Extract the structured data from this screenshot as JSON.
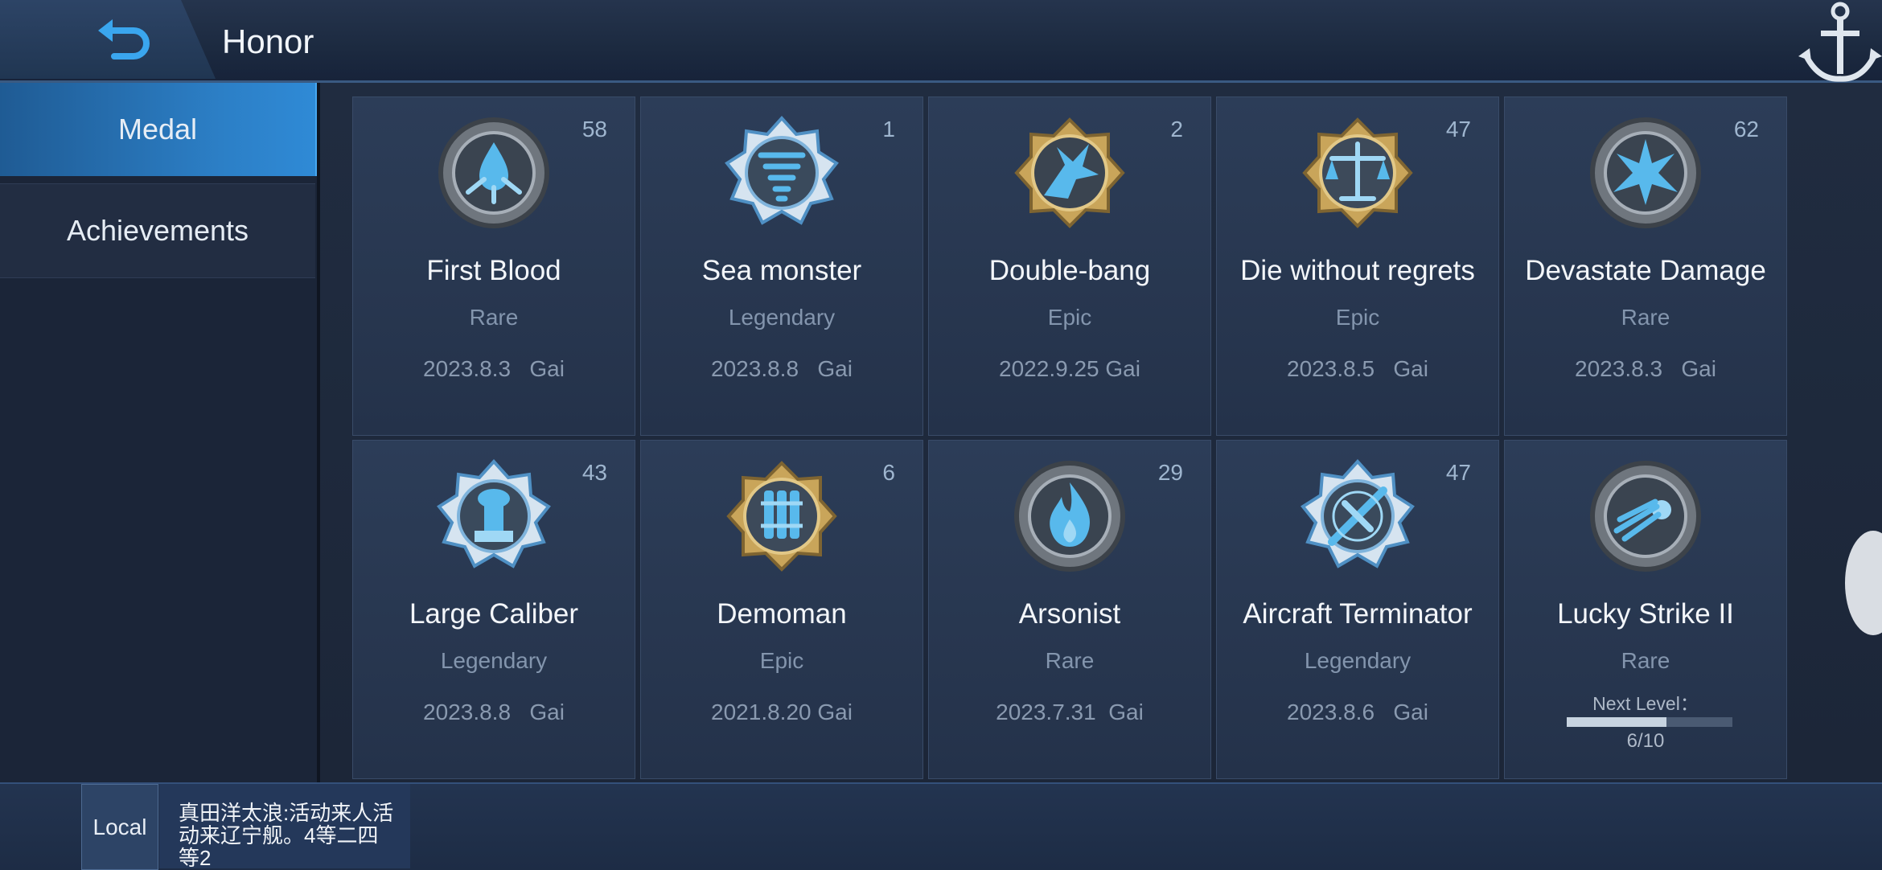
{
  "header": {
    "title": "Honor",
    "back_icon": "back-arrow-icon",
    "corner_icon": "anchor-icon"
  },
  "sidebar": {
    "items": [
      {
        "label": "Medal",
        "active": true
      },
      {
        "label": "Achievements",
        "active": false
      }
    ]
  },
  "medals": [
    {
      "name": "First Blood",
      "rarity": "Rare",
      "count": "58",
      "date": "2023.8.3",
      "ship": "Gai",
      "icon": "water-burst-medal-icon"
    },
    {
      "name": "Sea monster",
      "rarity": "Legendary",
      "count": "1",
      "date": "2023.8.8",
      "ship": "Gai",
      "icon": "tornado-medal-icon"
    },
    {
      "name": "Double-bang",
      "rarity": "Epic",
      "count": "2",
      "date": "2022.9.25",
      "ship": "Gai",
      "icon": "double-blast-medal-icon"
    },
    {
      "name": "Die without regrets",
      "rarity": "Epic",
      "count": "47",
      "date": "2023.8.5",
      "ship": "Gai",
      "icon": "scales-medal-icon"
    },
    {
      "name": "Devastate Damage",
      "rarity": "Rare",
      "count": "62",
      "date": "2023.8.3",
      "ship": "Gai",
      "icon": "explosion-medal-icon"
    },
    {
      "name": "Large Caliber",
      "rarity": "Legendary",
      "count": "43",
      "date": "2023.8.8",
      "ship": "Gai",
      "icon": "cannon-medal-icon"
    },
    {
      "name": "Demoman",
      "rarity": "Epic",
      "count": "6",
      "date": "2021.8.20",
      "ship": "Gai",
      "icon": "dynamite-medal-icon"
    },
    {
      "name": "Arsonist",
      "rarity": "Rare",
      "count": "29",
      "date": "2023.7.31",
      "ship": "Gai",
      "icon": "flame-medal-icon"
    },
    {
      "name": "Aircraft Terminator",
      "rarity": "Legendary",
      "count": "47",
      "date": "2023.8.6",
      "ship": "Gai",
      "icon": "crossed-plane-medal-icon"
    },
    {
      "name": "Lucky Strike II",
      "rarity": "Rare",
      "count": "",
      "icon": "comet-medal-icon",
      "next_level_label": "Next Level：",
      "progress_text": "6/10",
      "progress": 0.6
    }
  ],
  "chat": {
    "channel": "Local",
    "message": "真田洋太浪:活动来人活动来辽宁舰。4等二四等2"
  },
  "colors": {
    "accent": "#2c7fc6",
    "gold": "#c9a55a",
    "silver": "#8e969f",
    "glow": "#58b9ec"
  }
}
